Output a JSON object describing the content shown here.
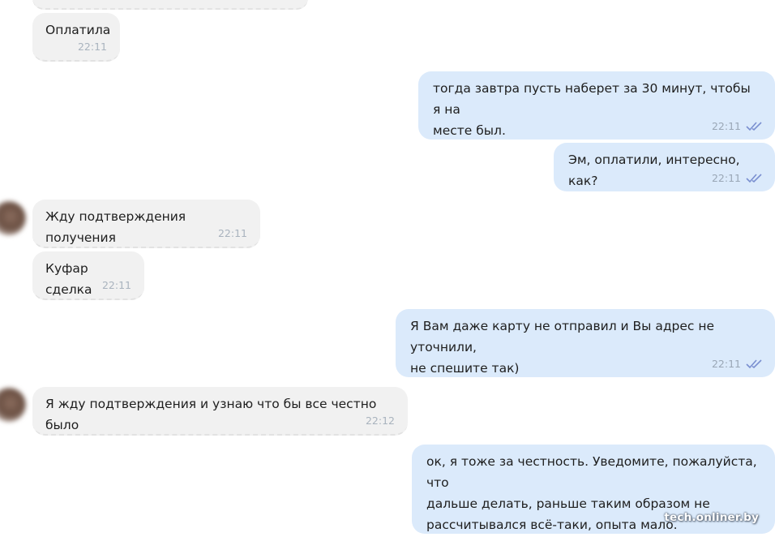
{
  "messages": [
    {
      "dir": "in",
      "text": "Оплатила",
      "time": "22:11"
    },
    {
      "dir": "out",
      "text": "тогда завтра пусть наберет за 30 минут, чтобы я на\nместе был.",
      "time": "22:11"
    },
    {
      "dir": "out",
      "text": "Эм, оплатили, интересно, как?",
      "time": "22:11"
    },
    {
      "dir": "in",
      "text": "Жду подтверждения получения",
      "time": "22:11"
    },
    {
      "dir": "in",
      "text": "Куфар сделка",
      "time": "22:11"
    },
    {
      "dir": "out",
      "text": "Я Вам даже карту не отправил и Вы адрес не уточнили,\nне спешите так)",
      "time": "22:11"
    },
    {
      "dir": "in",
      "text": "Я жду подтверждения и узнаю что бы все честно было",
      "time": "22:12"
    },
    {
      "dir": "out",
      "text": "ок, я тоже за честность. Уведомите, пожалуйста, что\nдальше делать, раньше таким образом не\nрассчитывался всё-таки, опыта мало.",
      "time": ""
    }
  ],
  "watermark": "tech.onliner.by",
  "colors": {
    "incoming_bubble": "#f1f1f1",
    "outgoing_bubble": "#dbeafb",
    "read_check": "#7a8fd0"
  }
}
